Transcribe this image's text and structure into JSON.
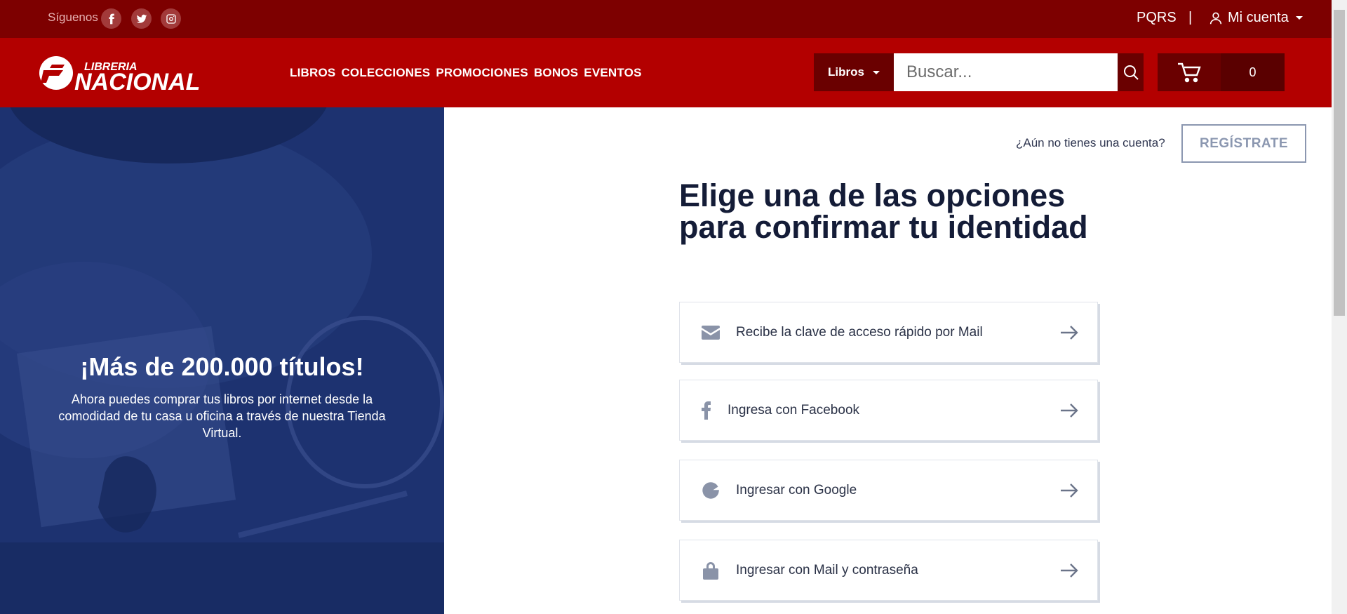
{
  "topbar": {
    "follow_label": "Síguenos",
    "social": [
      "facebook-icon",
      "twitter-icon",
      "instagram-icon"
    ],
    "pqrs": "PQRS",
    "separator": "|",
    "account": "Mi cuenta"
  },
  "header": {
    "logo_top": "LIBRERIA",
    "logo_bottom": "NACIONAL",
    "nav": [
      "LIBROS",
      "COLECCIONES",
      "PROMOCIONES",
      "BONOS",
      "EVENTOS"
    ],
    "category": "Libros",
    "search_placeholder": "Buscar...",
    "cart_count": "0"
  },
  "hero": {
    "title": "¡Más de 200.000 títulos!",
    "subtitle": "Ahora puedes comprar tus libros por internet desde la comodidad de tu casa u oficina a través de nuestra Tienda Virtual."
  },
  "auth": {
    "no_account": "¿Aún no tienes una cuenta?",
    "register": "REGÍSTRATE",
    "heading": "Elige una de las opciones para confirmar tu identidad",
    "options": [
      {
        "label": "Recibe la clave de acceso rápido por Mail",
        "icon": "envelope-icon"
      },
      {
        "label": "Ingresa con Facebook",
        "icon": "facebook-icon"
      },
      {
        "label": "Ingresar con Google",
        "icon": "google-icon"
      },
      {
        "label": "Ingresar con Mail y contraseña",
        "icon": "lock-icon"
      }
    ]
  },
  "colors": {
    "topbar": "#7d0000",
    "header": "#b30000",
    "hero": "#1d3270",
    "heading": "#141c37"
  }
}
